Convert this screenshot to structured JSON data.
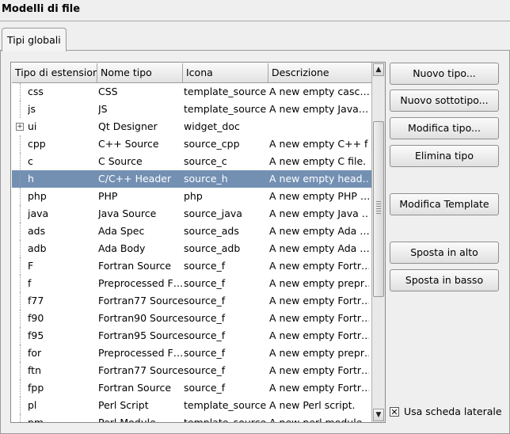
{
  "window": {
    "title": "Modelli di file"
  },
  "tabs": [
    {
      "label": "Tipi globali"
    }
  ],
  "table": {
    "headers": [
      "Tipo di estensione",
      "Nome tipo",
      "Icona",
      "Descrizione"
    ],
    "rows": [
      {
        "ext": "css",
        "name": "CSS",
        "icon": "template_source",
        "desc": "A new empty casc…"
      },
      {
        "ext": "js",
        "name": "JS",
        "icon": "template_source",
        "desc": "A new empty Java…"
      },
      {
        "ext": "ui",
        "name": "Qt Designer",
        "icon": "widget_doc",
        "desc": "",
        "expandable": true
      },
      {
        "ext": "cpp",
        "name": "C++ Source",
        "icon": "source_cpp",
        "desc": "A new empty C++ f…"
      },
      {
        "ext": "c",
        "name": "C Source",
        "icon": "source_c",
        "desc": "A new empty C file."
      },
      {
        "ext": "h",
        "name": "C/C++ Header",
        "icon": "source_h",
        "desc": "A new empty head…",
        "selected": true
      },
      {
        "ext": "php",
        "name": "PHP",
        "icon": "php",
        "desc": "A new empty PHP …"
      },
      {
        "ext": "java",
        "name": "Java Source",
        "icon": "source_java",
        "desc": "A new empty Java …"
      },
      {
        "ext": "ads",
        "name": "Ada Spec",
        "icon": "source_ads",
        "desc": "A new empty Ada …"
      },
      {
        "ext": "adb",
        "name": "Ada Body",
        "icon": "source_adb",
        "desc": "A new empty Ada …"
      },
      {
        "ext": "F",
        "name": "Fortran Source",
        "icon": "source_f",
        "desc": "A new empty Fortr…"
      },
      {
        "ext": "f",
        "name": "Preprocessed F…",
        "icon": "source_f",
        "desc": "A new empty prepr…"
      },
      {
        "ext": "f77",
        "name": "Fortran77 Source",
        "icon": "source_f",
        "desc": "A new empty Fortr…"
      },
      {
        "ext": "f90",
        "name": "Fortran90 Source",
        "icon": "source_f",
        "desc": "A new empty Fortr…"
      },
      {
        "ext": "f95",
        "name": "Fortran95 Source",
        "icon": "source_f",
        "desc": "A new empty Fortr…"
      },
      {
        "ext": "for",
        "name": "Preprocessed F…",
        "icon": "source_f",
        "desc": "A new empty prepr…"
      },
      {
        "ext": "ftn",
        "name": "Fortran77 Source",
        "icon": "source_f",
        "desc": "A new empty Fortr…"
      },
      {
        "ext": "fpp",
        "name": "Fortran Source",
        "icon": "source_f",
        "desc": "A new empty Fortr…"
      },
      {
        "ext": "pl",
        "name": "Perl Script",
        "icon": "template_source",
        "desc": "A new Perl script."
      },
      {
        "ext": "pm",
        "name": "Perl Module",
        "icon": "template_source",
        "desc": "A new perl module…"
      }
    ]
  },
  "buttons": {
    "new_type": "Nuovo tipo...",
    "new_subtype": "Nuovo sottotipo...",
    "edit_type": "Modifica tipo...",
    "delete_type": "Elimina tipo",
    "edit_template": "Modifica Template",
    "move_up": "Sposta in alto",
    "move_down": "Sposta in basso"
  },
  "sidebar_option": {
    "label": "Usa scheda laterale",
    "checked": true
  },
  "icons": {
    "checkbox": "x-mark-icon",
    "scroll_up": "arrow-up-icon",
    "scroll_down": "arrow-down-icon",
    "expander": "plus-icon"
  },
  "colors": {
    "selection": "#7390b3"
  }
}
